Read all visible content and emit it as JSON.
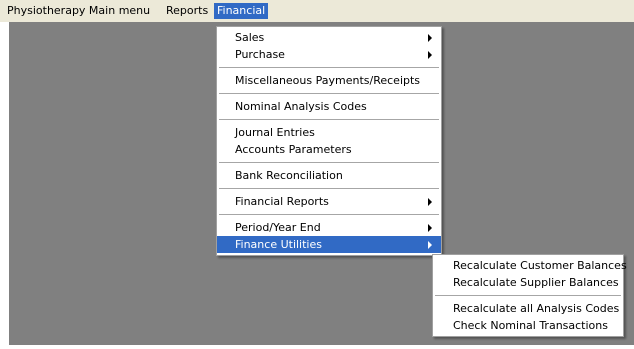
{
  "menubar": {
    "items": [
      "Physiotherapy Main menu",
      "Reports",
      "Financial"
    ]
  },
  "financial_menu": {
    "groups": [
      [
        {
          "label": "Sales",
          "submenu": true
        },
        {
          "label": "Purchase",
          "submenu": true
        }
      ],
      [
        {
          "label": "Miscellaneous Payments/Receipts"
        }
      ],
      [
        {
          "label": "Nominal Analysis Codes"
        }
      ],
      [
        {
          "label": "Journal Entries"
        },
        {
          "label": "Accounts Parameters"
        }
      ],
      [
        {
          "label": "Bank Reconciliation"
        }
      ],
      [
        {
          "label": "Financial Reports",
          "submenu": true
        }
      ],
      [
        {
          "label": "Period/Year End",
          "submenu": true
        },
        {
          "label": "Finance Utilities",
          "submenu": true,
          "highlighted": true
        }
      ]
    ]
  },
  "utilities_submenu": {
    "groups": [
      [
        {
          "label": "Recalculate Customer Balances"
        },
        {
          "label": "Recalculate Supplier Balances"
        }
      ],
      [
        {
          "label": "Recalculate all Analysis Codes"
        },
        {
          "label": "Check Nominal Transactions"
        }
      ]
    ]
  },
  "colors": {
    "highlight": "#316ac5",
    "menubar_bg": "#ece9d8",
    "workspace_bg": "#808080"
  }
}
